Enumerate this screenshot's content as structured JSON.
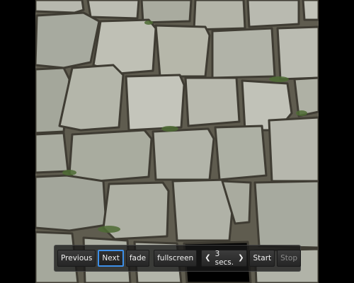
{
  "slideshow": {
    "image": {
      "subject": "stone-wall-photo"
    },
    "controls": {
      "previous_label": "Previous",
      "next_label": "Next",
      "transition_label": "fade",
      "fullscreen_label": "fullscreen",
      "delay_label": "3 secs.",
      "start_label": "Start",
      "stop_label": "Stop",
      "decrease_icon": "chevron-left-icon",
      "increase_icon": "chevron-right-icon",
      "accent_color": "#2f7fe0"
    }
  }
}
